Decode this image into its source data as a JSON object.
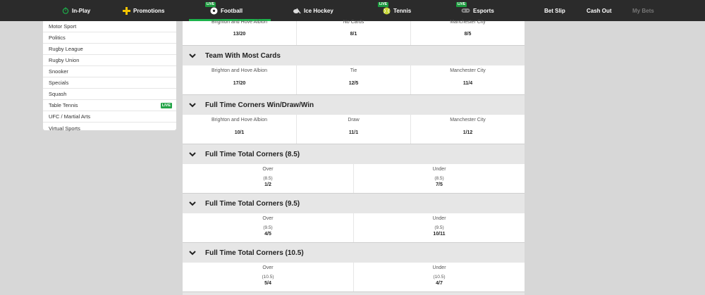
{
  "nav": {
    "inplay": "In-Play",
    "promotions": "Promotions",
    "football": "Football",
    "icehockey": "Ice Hockey",
    "tennis": "Tennis",
    "esports": "Esports",
    "betslip": "Bet Slip",
    "cashout": "Cash Out",
    "mybets": "My Bets",
    "live": "LIVE"
  },
  "sidebar": {
    "items": [
      {
        "label": "Motor Sport"
      },
      {
        "label": "Politics"
      },
      {
        "label": "Rugby League"
      },
      {
        "label": "Rugby Union"
      },
      {
        "label": "Snooker"
      },
      {
        "label": "Specials"
      },
      {
        "label": "Squash"
      },
      {
        "label": "Table Tennis",
        "badge": "LIVE"
      },
      {
        "label": "UFC / Martial Arts"
      },
      {
        "label": "Virtual Sports"
      }
    ]
  },
  "markets": {
    "partial": {
      "labels": [
        "Brighton and Hove Albion",
        "No Cards",
        "Manchester City"
      ],
      "odds": [
        "13/20",
        "8/1",
        "8/5"
      ]
    },
    "most_cards": {
      "title": "Team With Most Cards",
      "labels": [
        "Brighton and Hove Albion",
        "Tie",
        "Manchester City"
      ],
      "odds": [
        "17/20",
        "12/5",
        "11/4"
      ]
    },
    "corners_wdw": {
      "title": "Full Time Corners Win/Draw/Win",
      "labels": [
        "Brighton and Hove Albion",
        "Draw",
        "Manchester City"
      ],
      "odds": [
        "10/1",
        "11/1",
        "1/12"
      ]
    },
    "corners_85": {
      "title": "Full Time Total Corners (8.5)",
      "over": "Over",
      "under": "Under",
      "line": "(8.5)",
      "odds": [
        "1/2",
        "7/5"
      ]
    },
    "corners_95": {
      "title": "Full Time Total Corners (9.5)",
      "over": "Over",
      "under": "Under",
      "line": "(9.5)",
      "odds": [
        "4/5",
        "10/11"
      ]
    },
    "corners_105": {
      "title": "Full Time Total Corners (10.5)",
      "over": "Over",
      "under": "Under",
      "line": "(10.5)",
      "odds": [
        "5/4",
        "4/7"
      ]
    }
  },
  "colors": {
    "nav_bg": "#2b2b2b",
    "live_green": "#1cb24b",
    "promo_yellow": "#f5c400"
  }
}
